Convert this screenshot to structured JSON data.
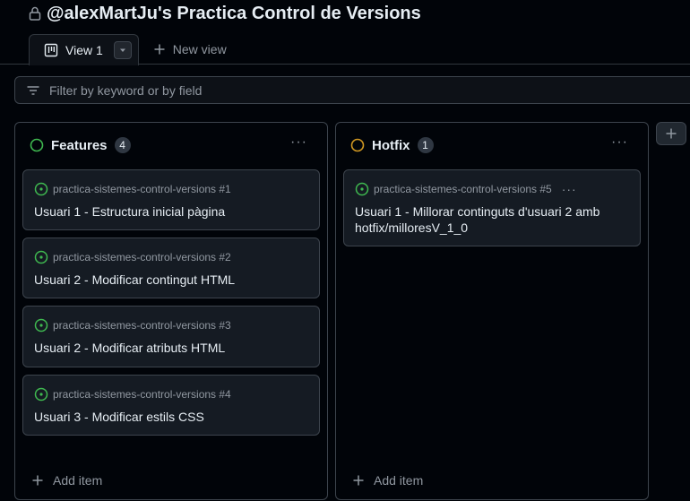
{
  "project": {
    "title": "@alexMartJu's Practica Control de Versions"
  },
  "tabs": {
    "active_label": "View 1",
    "new_view_label": "New view"
  },
  "filter": {
    "placeholder": "Filter by keyword or by field"
  },
  "columns": [
    {
      "name": "Features",
      "count": "4",
      "status_color": "#3fb950",
      "add_item_label": "Add item",
      "cards": [
        {
          "repo": "practica-sistemes-control-versions #1",
          "title": "Usuari 1 - Estructura inicial pàgina"
        },
        {
          "repo": "practica-sistemes-control-versions #2",
          "title": "Usuari 2 - Modificar contingut HTML"
        },
        {
          "repo": "practica-sistemes-control-versions #3",
          "title": "Usuari 2 - Modificar atributs HTML"
        },
        {
          "repo": "practica-sistemes-control-versions #4",
          "title": "Usuari 3 - Modificar estils CSS"
        }
      ]
    },
    {
      "name": "Hotfix",
      "count": "1",
      "status_color": "#d29922",
      "add_item_label": "Add item",
      "cards": [
        {
          "repo": "practica-sistemes-control-versions #5",
          "title": "Usuari 1 - Millorar continguts d'usuari 2 amb hotfix/milloresV_1_0"
        }
      ]
    }
  ],
  "colors": {
    "issue_open": "#3fb950",
    "accent_text": "#e6edf3",
    "muted_text": "#9198a1"
  },
  "icons": {
    "lock": "lock-icon",
    "view": "table-view-icon",
    "dropdown": "triangle-down-icon",
    "plus": "plus-icon",
    "filter": "filter-icon",
    "issue_open": "issue-opened-icon",
    "kebab": "kebab-horizontal-icon"
  }
}
